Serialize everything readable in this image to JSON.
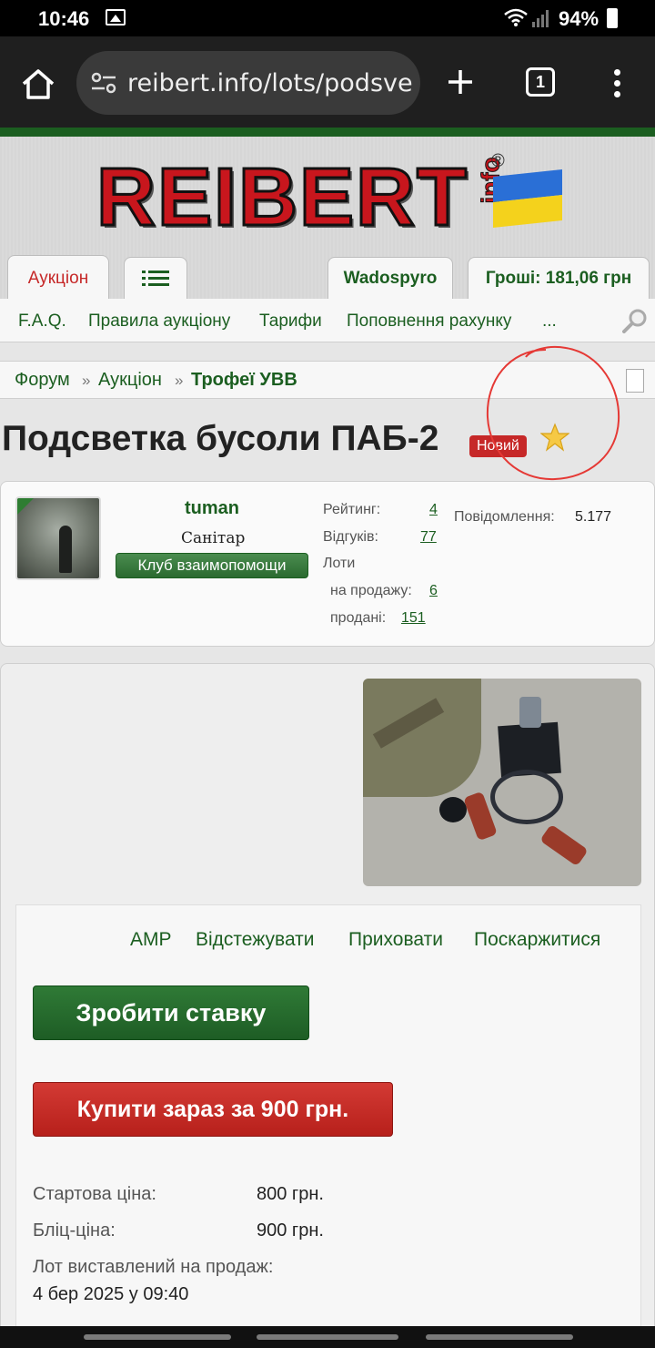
{
  "status": {
    "time": "10:46",
    "battery": "94%"
  },
  "browser": {
    "url": "reibert.info/lots/podsve",
    "tab_count": "1"
  },
  "logo": {
    "brand": "REIBERT",
    "suffix": "info",
    "reg": "®"
  },
  "tabs": {
    "auction": "Аукціон",
    "user": "Wadospyro",
    "money": "Гроші: 181,06 грн"
  },
  "nav": [
    "F.A.Q.",
    "Правила аукціону",
    "Тарифи",
    "Поповнення рахунку",
    "..."
  ],
  "breadcrumbs": {
    "forum": "Форум",
    "auction": "Аукціон",
    "current": "Трофеї УВВ",
    "sep": "»"
  },
  "lot": {
    "title": "Подсветка бусоли ПАБ-2",
    "badge": "Новий"
  },
  "seller": {
    "name": "tuman",
    "title": "Санітар",
    "club": "Клуб взаимопомощи",
    "rating_label": "Рейтинг:",
    "rating": "4",
    "reviews_label": "Відгуків:",
    "reviews": "77",
    "lots_label": "Лоти",
    "for_sale_label": "на продажу:",
    "for_sale": "6",
    "sold_label": "продані:",
    "sold": "151",
    "messages_label": "Повідомлення:",
    "messages": "5.177"
  },
  "actions": {
    "amp": "AMP",
    "track": "Відстежувати",
    "hide": "Приховати",
    "report": "Поскаржитися"
  },
  "buttons": {
    "bid": "Зробити ставку",
    "buy": "Купити зараз за 900 грн."
  },
  "details": {
    "start_label": "Стартова ціна:",
    "start_value": "800 грн.",
    "blitz_label": "Бліц-ціна:",
    "blitz_value": "900 грн.",
    "listed_label": "Лот виставлений на продаж:",
    "listed_value": "4 бер 2025 у 09:40"
  },
  "colors": {
    "accent_green": "#1b5e20",
    "accent_red": "#c62828",
    "annotation": "#e53935"
  }
}
